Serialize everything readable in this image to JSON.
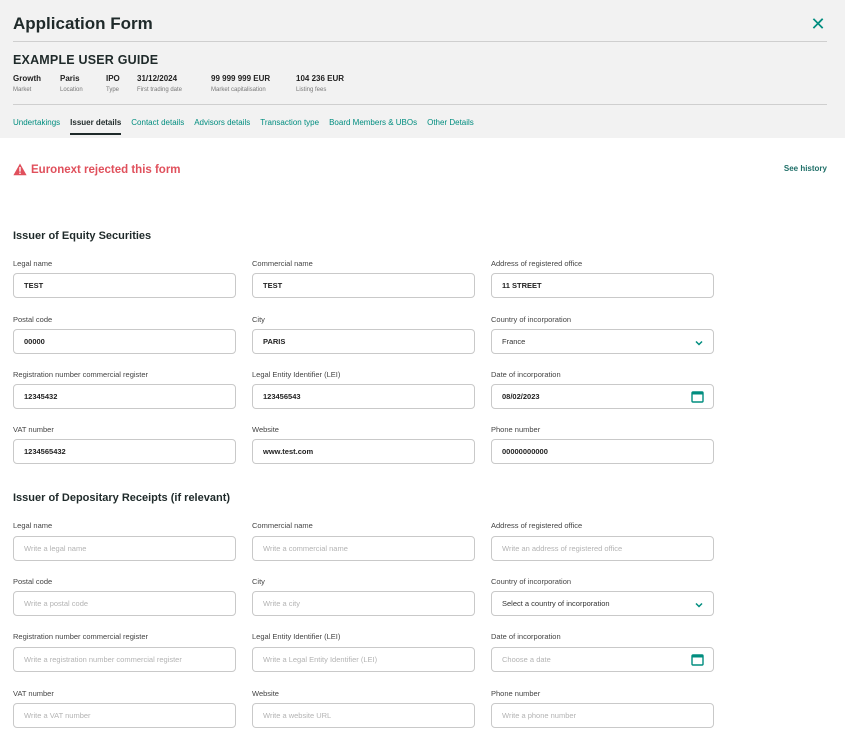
{
  "header": {
    "title": "Application Form",
    "guide_title": "EXAMPLE USER GUIDE",
    "meta": [
      {
        "value": "Growth",
        "label": "Market"
      },
      {
        "value": "Paris",
        "label": "Location"
      },
      {
        "value": "IPO",
        "label": "Type"
      },
      {
        "value": "31/12/2024",
        "label": "First trading date"
      },
      {
        "value": "99 999 999 EUR",
        "label": "Market capitalisation"
      },
      {
        "value": "104 236 EUR",
        "label": "Listing fees"
      }
    ],
    "tabs": [
      "Undertakings",
      "Issuer details",
      "Contact details",
      "Advisors details",
      "Transaction type",
      "Board Members & UBOs",
      "Other Details"
    ],
    "active_tab": "Issuer details"
  },
  "alert": {
    "text": "Euronext rejected this form",
    "see_history": "See history",
    "color": "#e0505c"
  },
  "colors": {
    "accent": "#008d7f",
    "header_bg": "#f2f2f2"
  },
  "section_equity": {
    "title": "Issuer of Equity Securities",
    "fields": {
      "legal_name": {
        "label": "Legal name",
        "value": "TEST"
      },
      "commercial_name": {
        "label": "Commercial name",
        "value": "TEST"
      },
      "address": {
        "label": "Address of registered office",
        "value": "11 STREET"
      },
      "postal_code": {
        "label": "Postal code",
        "value": "00000"
      },
      "city": {
        "label": "City",
        "value": "PARIS"
      },
      "country": {
        "label": "Country of incorporation",
        "value": "France"
      },
      "registration_number": {
        "label": "Registration number commercial register",
        "value": "12345432"
      },
      "lei": {
        "label": "Legal Entity Identifier (LEI)",
        "value": "123456543"
      },
      "date_incorporation": {
        "label": "Date of incorporation",
        "value": "08/02/2023"
      },
      "vat_number": {
        "label": "VAT number",
        "value": "1234565432"
      },
      "website": {
        "label": "Website",
        "value": "www.test.com"
      },
      "phone": {
        "label": "Phone number",
        "value": "00000000000"
      }
    }
  },
  "section_depositary": {
    "title": "Issuer of Depositary Receipts (if relevant)",
    "fields": {
      "legal_name": {
        "label": "Legal name",
        "placeholder": "Write a legal name"
      },
      "commercial_name": {
        "label": "Commercial name",
        "placeholder": "Write a commercial name"
      },
      "address": {
        "label": "Address of registered office",
        "placeholder": "Write an address of registered office"
      },
      "postal_code": {
        "label": "Postal code",
        "placeholder": "Write a postal code"
      },
      "city": {
        "label": "City",
        "placeholder": "Write a city"
      },
      "country": {
        "label": "Country of incorporation",
        "placeholder": "Select a country of incorporation"
      },
      "registration_number": {
        "label": "Registration number commercial register",
        "placeholder": "Write a registration number commercial register"
      },
      "lei": {
        "label": "Legal Entity Identifier (LEI)",
        "placeholder": "Write a Legal Entity Identifier (LEI)"
      },
      "date_incorporation": {
        "label": "Date of incorporation",
        "placeholder": "Choose a date"
      },
      "vat_number": {
        "label": "VAT number",
        "placeholder": "Write a VAT number"
      },
      "website": {
        "label": "Website",
        "placeholder": "Write a website URL"
      },
      "phone": {
        "label": "Phone number",
        "placeholder": "Write a phone number"
      }
    }
  }
}
